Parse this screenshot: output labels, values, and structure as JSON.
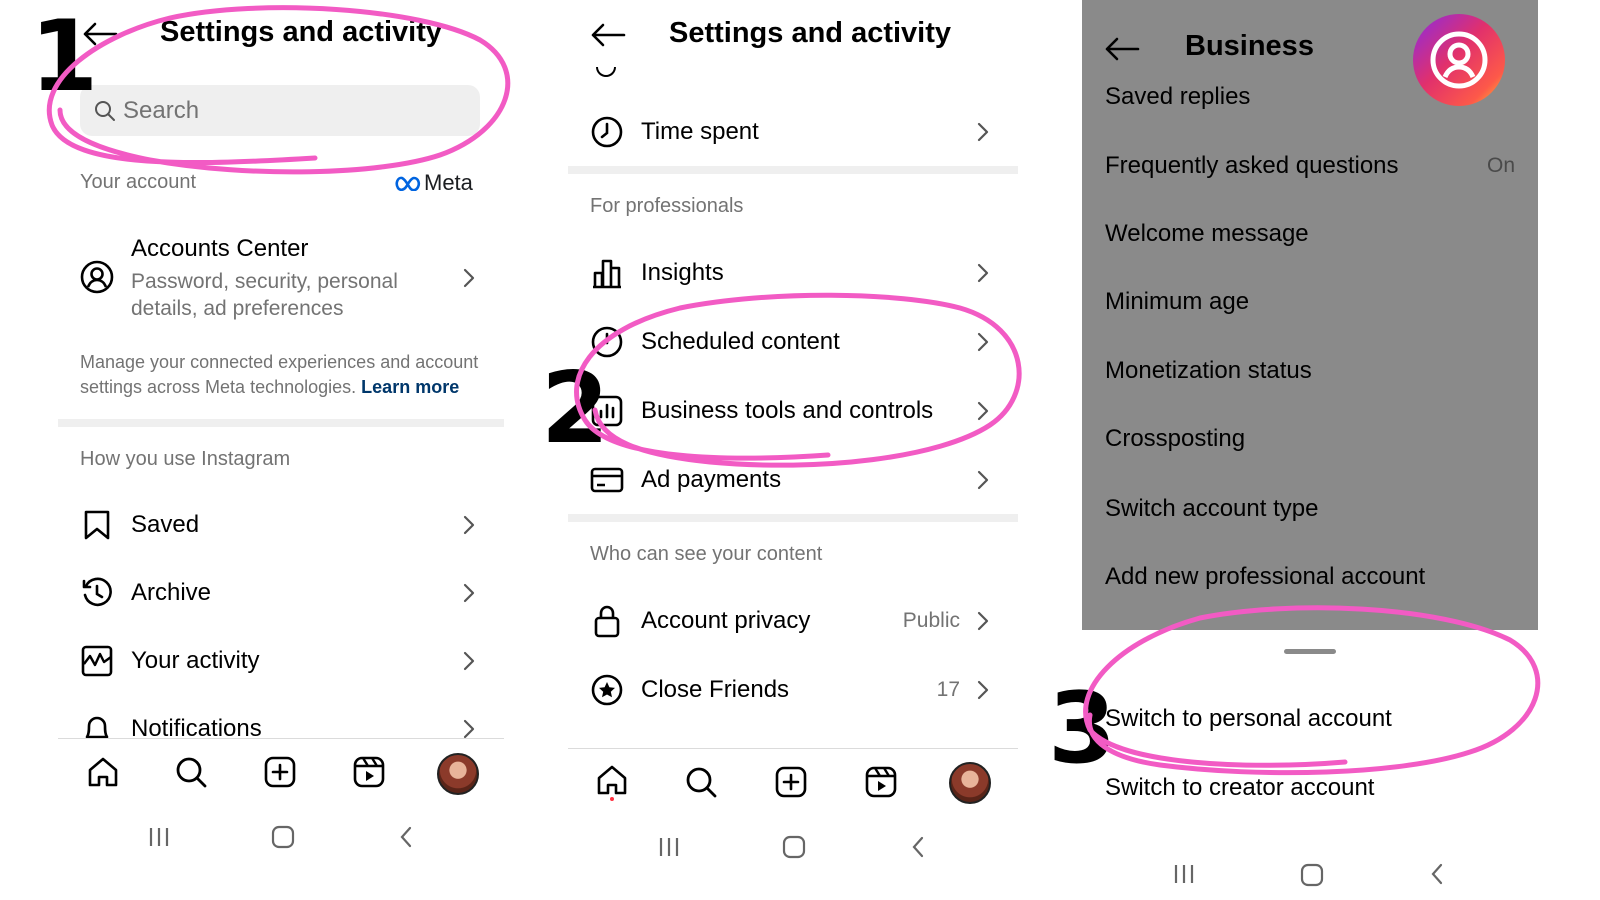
{
  "panel1": {
    "title": "Settings and activity",
    "search_placeholder": "Search",
    "your_account_label": "Your account",
    "meta_logo_text": "Meta",
    "accounts_center": {
      "title": "Accounts Center",
      "subtitle_line1": "Password, security, personal",
      "subtitle_line2": "details, ad preferences"
    },
    "manage_text_line1": "Manage your connected experiences and account",
    "manage_text_line2": "settings across Meta technologies.",
    "learn_more": "Learn more",
    "how_you_use_label": "How you use Instagram",
    "items": [
      {
        "label": "Saved",
        "icon": "bookmark-icon"
      },
      {
        "label": "Archive",
        "icon": "archive-icon"
      },
      {
        "label": "Your activity",
        "icon": "activity-icon"
      },
      {
        "label": "Notifications",
        "icon": "bell-icon"
      }
    ]
  },
  "panel2": {
    "title": "Settings and activity",
    "time_spent": "Time spent",
    "for_professionals_label": "For professionals",
    "pro_items": [
      {
        "label": "Insights",
        "icon": "bar-chart-icon"
      },
      {
        "label": "Scheduled content",
        "icon": "clock-icon"
      },
      {
        "label": "Business tools and controls",
        "icon": "business-tools-icon"
      },
      {
        "label": "Ad payments",
        "icon": "credit-card-icon"
      }
    ],
    "who_can_see_label": "Who can see your content",
    "privacy_items": [
      {
        "label": "Account privacy",
        "value": "Public",
        "icon": "lock-icon"
      },
      {
        "label": "Close Friends",
        "value": "17",
        "icon": "star-circle-icon"
      }
    ]
  },
  "panel3": {
    "title": "Business",
    "items": [
      "Saved replies",
      "Frequently asked questions",
      "Welcome message",
      "Minimum age",
      "Monetization status",
      "Crossposting",
      "Switch account type",
      "Add new professional account"
    ],
    "faq_value": "On",
    "sheet_items": [
      "Switch to personal account",
      "Switch to creator account"
    ]
  },
  "steps": [
    "1",
    "2",
    "3"
  ],
  "colors": {
    "annotation_pink": "#f25bc4",
    "link_blue": "#00376b",
    "meta_blue": "#0064e0",
    "secondary_text": "#737373",
    "dim_overlay": "#8a8a8a"
  }
}
